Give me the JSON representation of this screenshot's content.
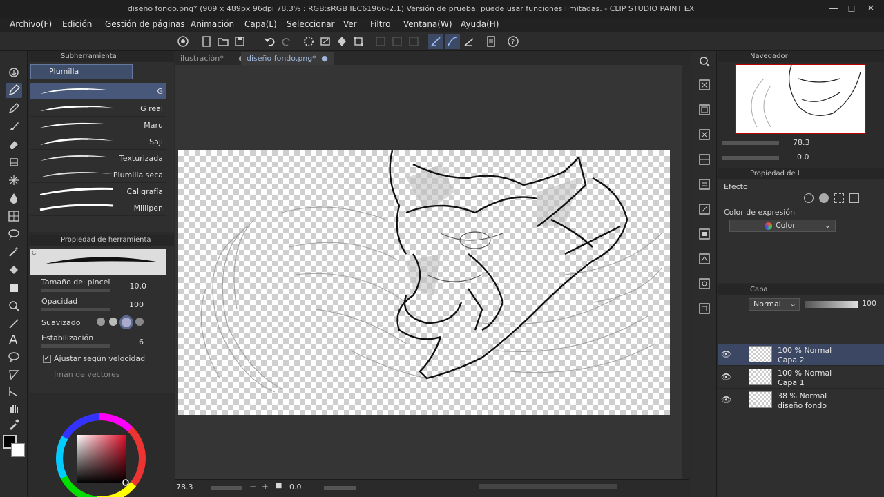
{
  "window": {
    "title": "diseño fondo.png* (909 x 489px 96dpi 78.3% : RGB:sRGB IEC61966-2.1)  Versión de prueba: puede usar funciones limitadas. - CLIP STUDIO PAINT EX",
    "minimize": "—",
    "maximize": "☐",
    "close": "✕"
  },
  "menu": [
    "Archivo(F)",
    "Edición",
    "Gestión de páginas",
    "Animación",
    "Capa(L)",
    "Seleccionar",
    "Ver",
    "Filtro",
    "Ventana(W)",
    "Ayuda(H)"
  ],
  "subtool": {
    "header": "Subherramienta",
    "group": "Plumilla",
    "brushes": [
      "G",
      "G real",
      "Maru",
      "Saji",
      "Texturizada",
      "Plumilla seca",
      "Caligrafía",
      "Millipen"
    ]
  },
  "tool_property": {
    "header": "Propiedad de herramienta",
    "badge": "G",
    "brush_size_label": "Tamaño del pincel",
    "brush_size_value": "10.0",
    "opacity_label": "Opacidad",
    "opacity_value": "100",
    "smoothing_label": "Suavizado",
    "stabilization_label": "Estabilización",
    "stabilization_value": "6",
    "adjust_speed_label": "Ajustar según velocidad",
    "vector_magnet_label": "Imán de vectores"
  },
  "tabs": [
    {
      "label": "ilustración*",
      "close": "●"
    },
    {
      "label": "diseño fondo.png*",
      "close": "●"
    }
  ],
  "status": {
    "zoom": "78.3",
    "rotation": "0.0"
  },
  "navigator": {
    "header": "Navegador",
    "zoom": "78.3",
    "rotation": "0.0"
  },
  "layer_property": {
    "header": "Propiedad de l",
    "effect_label": "Efecto",
    "expression_label": "Color de expresión",
    "expression_value": "Color"
  },
  "layers": {
    "header": "Capa",
    "blend_mode": "Normal",
    "opacity": "100",
    "items": [
      {
        "line1": "100 % Normal",
        "line2": "Capa 2",
        "selected": true
      },
      {
        "line1": "100 % Normal",
        "line2": "Capa 1",
        "selected": false
      },
      {
        "line1": "38 % Normal",
        "line2": "diseño fondo",
        "selected": false
      }
    ]
  },
  "colors": {
    "accent": "#48587a",
    "selection": "#3b4763",
    "main_color": "#000000",
    "sub_color": "#ffffff"
  }
}
